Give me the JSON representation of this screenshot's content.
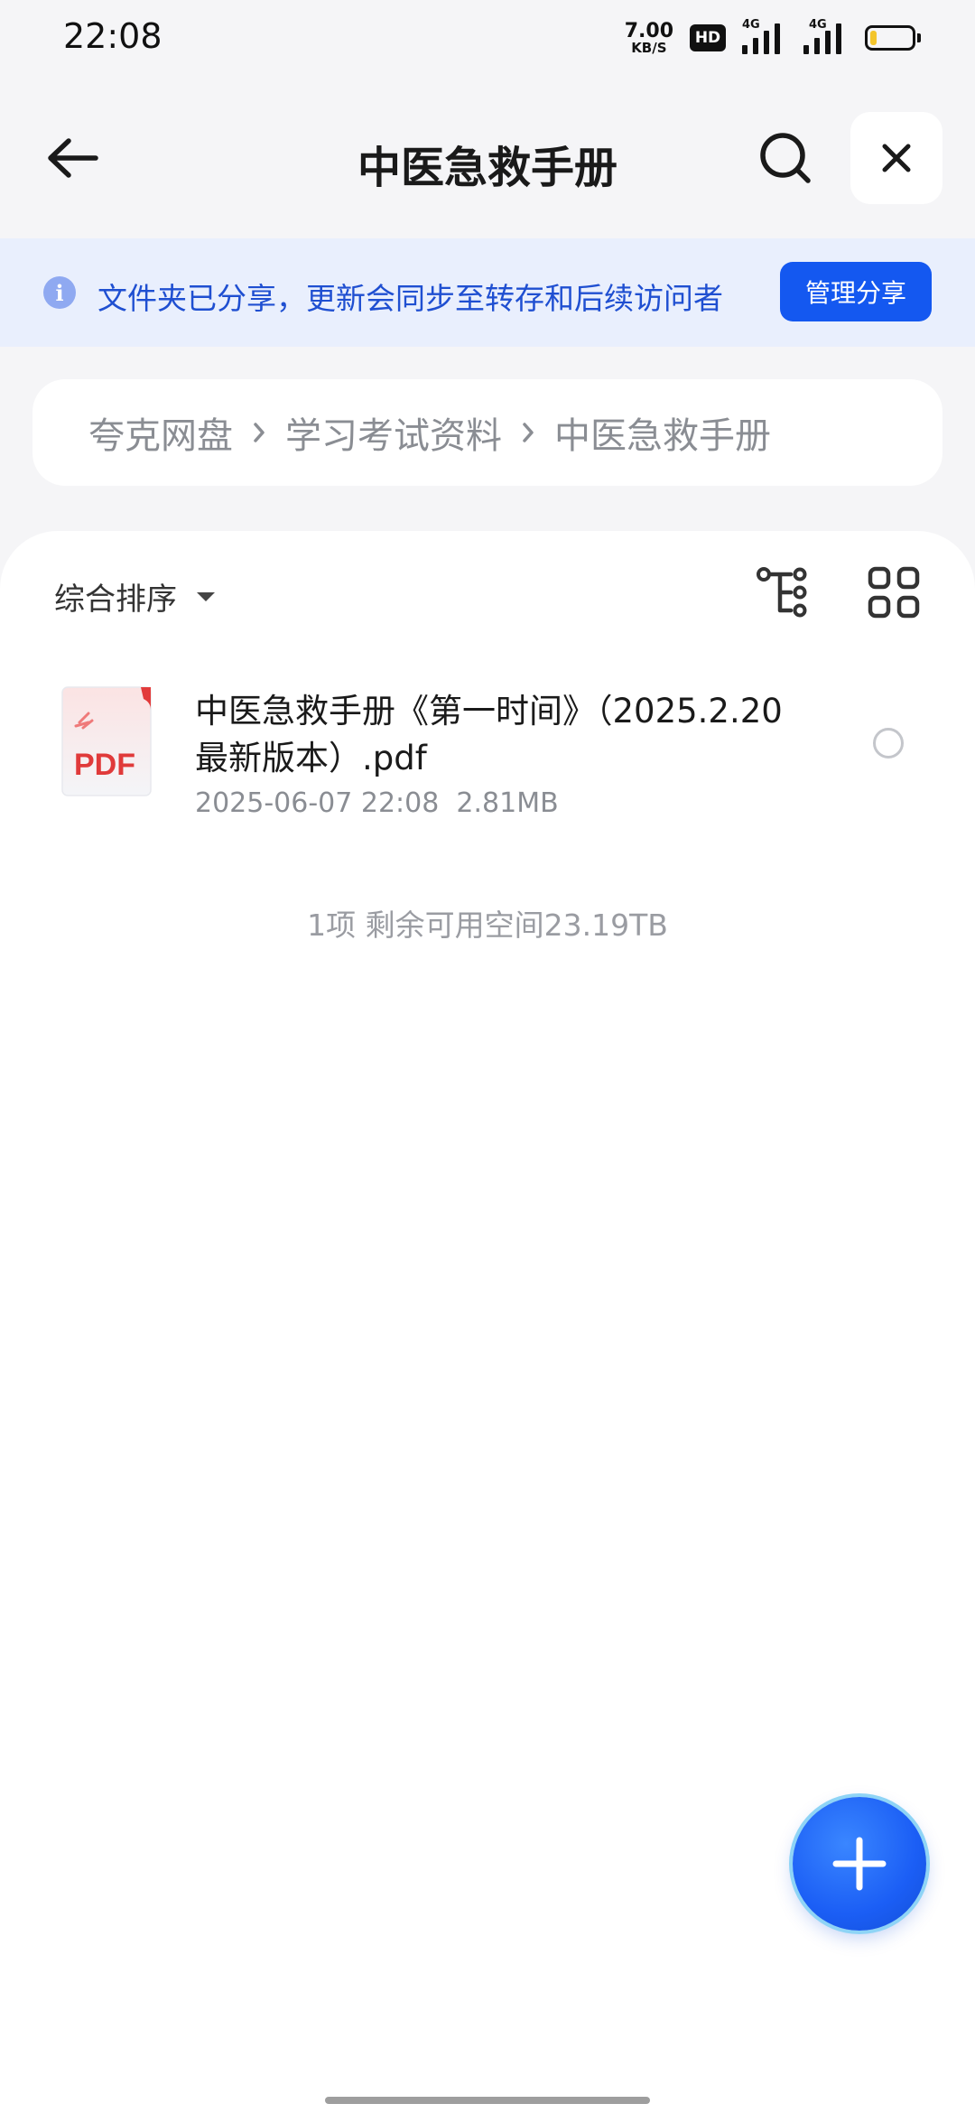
{
  "status_bar": {
    "time": "22:08",
    "net_speed_value": "7.00",
    "net_speed_unit": "KB/S",
    "hd_label": "HD",
    "sim1_label": "4G",
    "sim2_label": "4G",
    "battery_level": 0.15,
    "battery_color": "#f3c52b"
  },
  "header": {
    "title": "中医急救手册",
    "back_icon": "arrow-left-icon",
    "search_icon": "search-icon",
    "close_icon": "close-icon"
  },
  "share_banner": {
    "icon": "info-icon",
    "icon_glyph": "i",
    "text": "文件夹已分享，更新会同步至转存和后续访问者",
    "button_label": "管理分享",
    "accent": "#1458f0",
    "background": "#e9effd"
  },
  "breadcrumb": {
    "items": [
      "夸克网盘",
      "学习考试资料",
      "中医急救手册"
    ],
    "separator_icon": "chevron-right-icon"
  },
  "toolbar": {
    "sort_label": "综合排序",
    "sort_caret_icon": "caret-down-icon",
    "tree_view_icon": "tree-view-icon",
    "grid_view_icon": "grid-view-icon"
  },
  "files": [
    {
      "name": "中医急救手册《第一时间》（2025.2.20最新版本）.pdf",
      "date": "2025-06-07 22:08",
      "size": "2.81MB",
      "icon_label": "PDF",
      "selected": false
    }
  ],
  "footer": {
    "summary": "1项 剩余可用空间23.19TB"
  },
  "fab": {
    "icon": "plus-icon",
    "color": "#1b5ef5"
  }
}
